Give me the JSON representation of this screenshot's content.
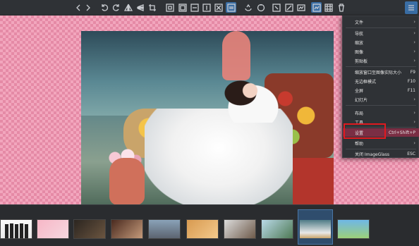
{
  "app": {
    "name": "ImageGlass"
  },
  "toolbar": {
    "buttons": [
      {
        "name": "previous-image-icon"
      },
      {
        "name": "next-image-icon"
      },
      {
        "name": "rotate-left-icon"
      },
      {
        "name": "rotate-right-icon"
      },
      {
        "name": "flip-horizontal-icon"
      },
      {
        "name": "flip-vertical-icon"
      },
      {
        "name": "crop-icon"
      },
      {
        "name": "actual-size-icon"
      },
      {
        "name": "auto-zoom-icon"
      },
      {
        "name": "scale-to-width-icon"
      },
      {
        "name": "scale-to-height-icon"
      },
      {
        "name": "scale-to-fit-icon"
      },
      {
        "name": "lock-zoom-icon"
      },
      {
        "name": "refresh-icon"
      },
      {
        "name": "fullscreen-icon"
      },
      {
        "name": "slideshow-icon"
      },
      {
        "name": "open-with-icon"
      },
      {
        "name": "thumbnail-bar-icon"
      },
      {
        "name": "checkerboard-icon"
      },
      {
        "name": "delete-icon"
      },
      {
        "name": "main-menu-icon"
      }
    ]
  },
  "menu": {
    "items": [
      {
        "label": "文件",
        "shortcut": "",
        "submenu": true
      },
      {
        "label": "导航",
        "shortcut": "",
        "submenu": true
      },
      {
        "label": "缩放",
        "shortcut": "",
        "submenu": true
      },
      {
        "label": "图像",
        "shortcut": "",
        "submenu": true
      },
      {
        "label": "剪贴板",
        "shortcut": "",
        "submenu": true
      },
      {
        "label": "缩放窗口至图像实际大小",
        "shortcut": "F9",
        "submenu": false
      },
      {
        "label": "无边框模式",
        "shortcut": "F10",
        "submenu": false
      },
      {
        "label": "全屏",
        "shortcut": "F11",
        "submenu": false
      },
      {
        "label": "幻灯片",
        "shortcut": "",
        "submenu": true
      },
      {
        "label": "布局",
        "shortcut": "",
        "submenu": true
      },
      {
        "label": "工具",
        "shortcut": "",
        "submenu": true
      },
      {
        "label": "设置",
        "shortcut": "Ctrl+Shift+P",
        "submenu": false
      },
      {
        "label": "帮助",
        "shortcut": "",
        "submenu": true
      },
      {
        "label": "关闭 ImageGlass",
        "shortcut": "ESC",
        "submenu": false
      }
    ],
    "highlighted": "设置"
  },
  "colors": {
    "accent": "#3a6ea5",
    "highlight": "#7a2e44",
    "callout": "#e0191f",
    "checker_a": "#f2a6bd",
    "checker_b": "#e58aa6"
  }
}
